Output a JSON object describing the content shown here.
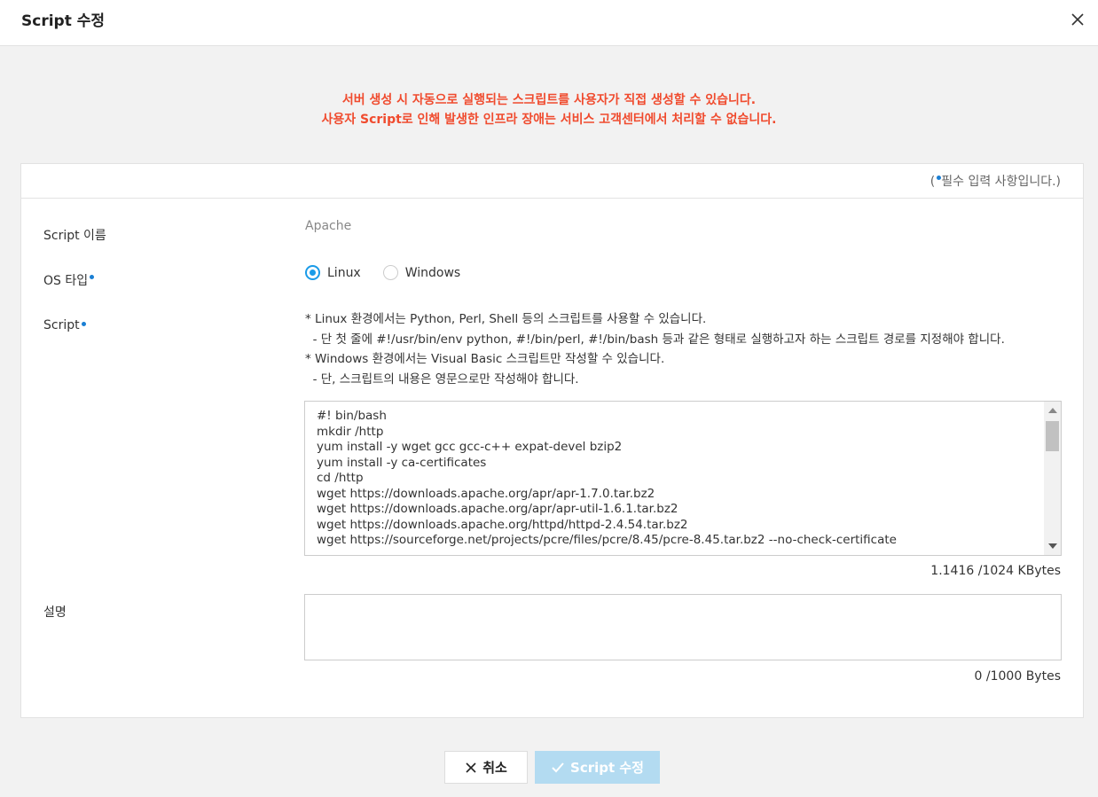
{
  "modal": {
    "title": "Script 수정"
  },
  "notice": {
    "line1": "서버 생성 시 자동으로 실행되는 스크립트를 사용자가 직접 생성할 수 있습니다.",
    "line2": "사용자 Script로 인해 발생한 인프라 장애는 서비스 고객센터에서 처리할 수 없습니다."
  },
  "form": {
    "required_note_prefix": "(",
    "required_note_text": "필수 입력 사항입니다.)",
    "script_name_label": "Script 이름",
    "script_name_value": "Apache",
    "os_type_label": "OS 타입",
    "os_options": [
      {
        "label": "Linux",
        "checked": true
      },
      {
        "label": "Windows",
        "checked": false
      }
    ],
    "script_label": "Script",
    "script_guide": "* Linux 환경에서는 Python, Perl, Shell 등의 스크립트를 사용할 수 있습니다.\n  - 단 첫 줄에 #!/usr/bin/env python, #!/bin/perl, #!/bin/bash 등과 같은 형태로 실행하고자 하는 스크립트 경로를 지정해야 합니다.\n* Windows 환경에서는 Visual Basic 스크립트만 작성할 수 있습니다.\n  - 단, 스크립트의 내용은 영문으로만 작성해야 합니다.",
    "script_content": "#! bin/bash\nmkdir /http\nyum install -y wget gcc gcc-c++ expat-devel bzip2\nyum install -y ca-certificates\ncd /http\nwget https://downloads.apache.org/apr/apr-1.7.0.tar.bz2\nwget https://downloads.apache.org/apr/apr-util-1.6.1.tar.bz2\nwget https://downloads.apache.org/httpd/httpd-2.4.54.tar.bz2\nwget https://sourceforge.net/projects/pcre/files/pcre/8.45/pcre-8.45.tar.bz2 --no-check-certificate",
    "script_size": "1.1416 /1024 KBytes",
    "desc_label": "설명",
    "desc_value": "",
    "desc_size": "0 /1000 Bytes"
  },
  "buttons": {
    "cancel_label": "취소",
    "save_label": "Script 수정"
  },
  "colors": {
    "notice": "#f04b2e",
    "accent": "#1a9be8",
    "required_dot": "#1a7fd4",
    "save_disabled": "#b3dbf1"
  }
}
